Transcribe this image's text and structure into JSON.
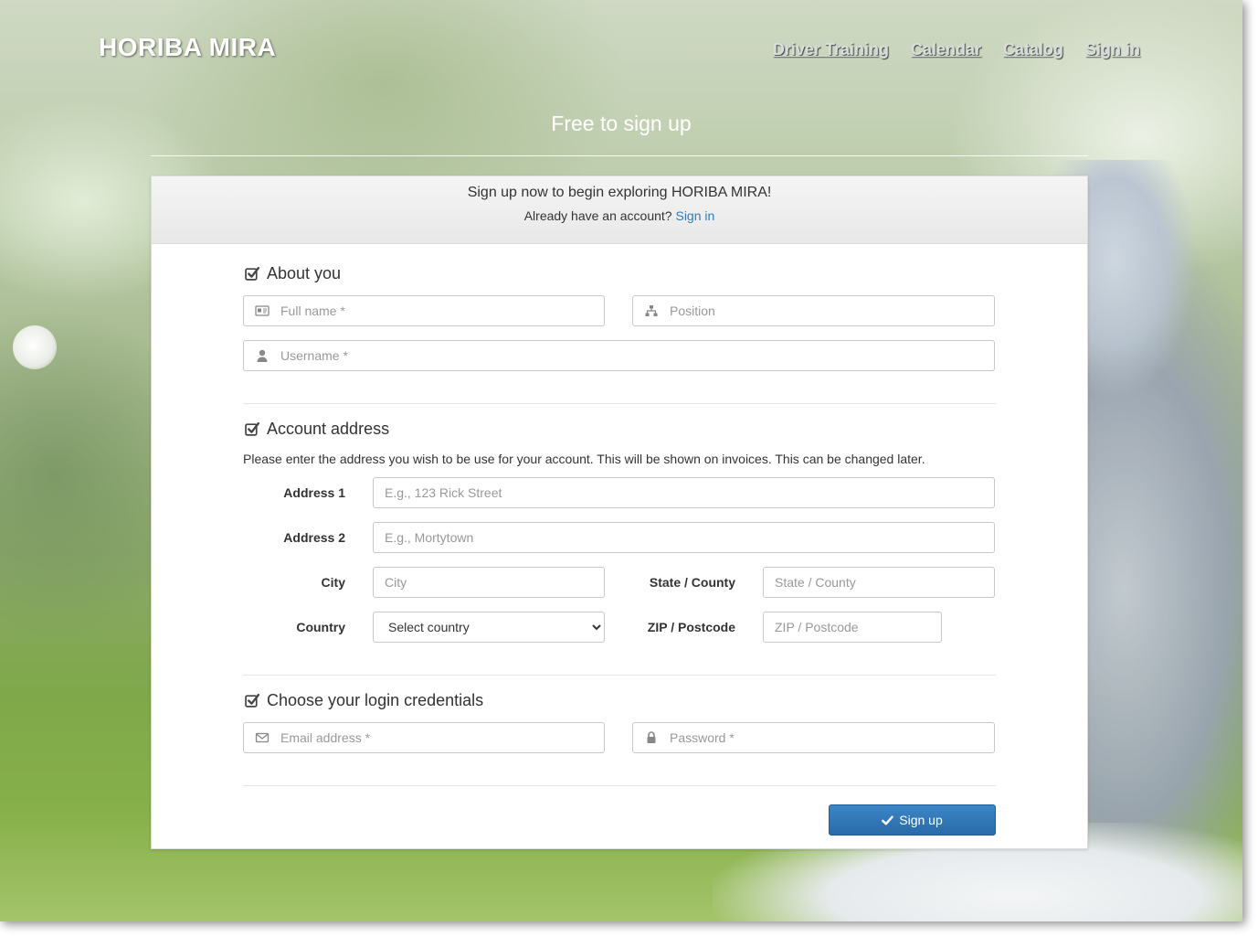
{
  "header": {
    "brand": "HORIBA MIRA",
    "nav": [
      "Driver Training",
      "Calendar",
      "Catalog",
      "Sign in"
    ],
    "hero_title": "Free to sign up"
  },
  "card": {
    "lead": "Sign up now to begin exploring HORIBA MIRA!",
    "already_text": "Already have an account?",
    "signin_link": "Sign in"
  },
  "about": {
    "title": "About you",
    "fullname_placeholder": "Full name *",
    "position_placeholder": "Position",
    "username_placeholder": "Username *"
  },
  "address": {
    "title": "Account address",
    "help": "Please enter the address you wish to be use for your account. This will be shown on invoices. This can be changed later.",
    "address1_label": "Address 1",
    "address1_placeholder": "E.g., 123 Rick Street",
    "address2_label": "Address 2",
    "address2_placeholder": "E.g., Mortytown",
    "city_label": "City",
    "city_placeholder": "City",
    "state_label": "State / County",
    "state_placeholder": "State / County",
    "country_label": "Country",
    "country_selected": "Select country",
    "zip_label": "ZIP / Postcode",
    "zip_placeholder": "ZIP / Postcode"
  },
  "credentials": {
    "title": "Choose your login credentials",
    "email_placeholder": "Email address *",
    "password_placeholder": "Password *"
  },
  "submit_label": "Sign up",
  "colors": {
    "accent": "#337ab7",
    "button": "#2a6aa8"
  }
}
